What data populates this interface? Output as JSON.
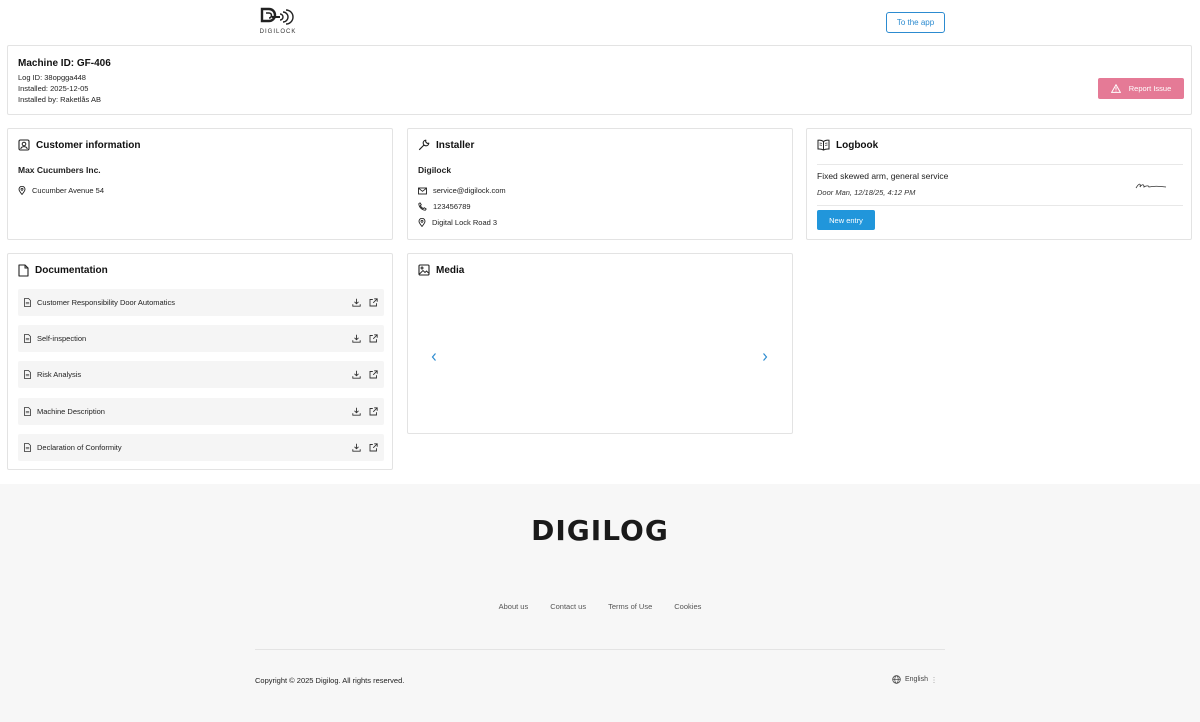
{
  "header": {
    "logo_text": "DIGILOCK",
    "to_app_label": "To the app"
  },
  "machine": {
    "title": "Machine ID: GF-406",
    "log_id": "Log ID: 38opgga448",
    "installed": "Installed: 2025-12-05",
    "installed_by": "Installed by: Raketlås AB",
    "report_label": "Report Issue"
  },
  "customer": {
    "heading": "Customer information",
    "name": "Max Cucumbers Inc.",
    "address": "Cucumber Avenue 54"
  },
  "installer": {
    "heading": "Installer",
    "name": "Digilock",
    "email": "service@digilock.com",
    "phone": "123456789",
    "address": "Digital Lock Road 3"
  },
  "logbook": {
    "heading": "Logbook",
    "entries": [
      {
        "text": "Fixed skewed arm, general service",
        "meta": "Door Man, 12/18/25, 4:12 PM"
      }
    ],
    "new_entry_label": "New entry"
  },
  "documentation": {
    "heading": "Documentation",
    "items": [
      {
        "label": "Customer Responsibility Door Automatics"
      },
      {
        "label": "Self-inspection"
      },
      {
        "label": "Risk Analysis"
      },
      {
        "label": "Machine Description"
      },
      {
        "label": "Declaration of Conformity"
      }
    ]
  },
  "media": {
    "heading": "Media"
  },
  "footer": {
    "brand": "DIGILOG",
    "links": [
      "About us",
      "Contact us",
      "Terms of Use",
      "Cookies"
    ],
    "copyright": "Copyright © 2025 Digilog. All rights reserved.",
    "language": "English"
  },
  "colors": {
    "accent": "#2196db",
    "report": "#e57a96",
    "footer_bg": "#f7f7f7"
  }
}
